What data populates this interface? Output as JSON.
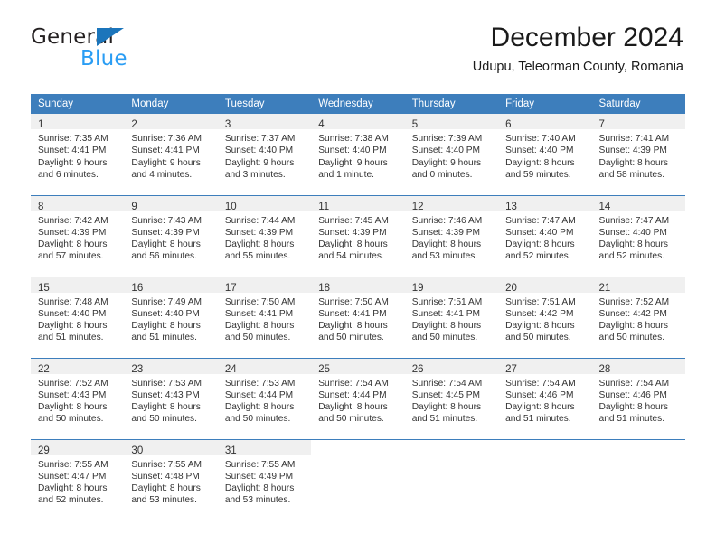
{
  "brand": {
    "name_dark": "General",
    "name_light": "Blue",
    "accent_blue": "#1b75bb",
    "light_blue": "#2a9df4"
  },
  "header": {
    "title": "December 2024",
    "subtitle": "Udupu, Teleorman County, Romania"
  },
  "theme": {
    "header_row_bg": "#3d7ebc",
    "daynum_band_bg": "#f0f0f0",
    "grid_line": "#3d7ebc",
    "text": "#333333"
  },
  "weekday_headers": [
    "Sunday",
    "Monday",
    "Tuesday",
    "Wednesday",
    "Thursday",
    "Friday",
    "Saturday"
  ],
  "weeks": [
    [
      {
        "day": "1",
        "sunrise": "Sunrise: 7:35 AM",
        "sunset": "Sunset: 4:41 PM",
        "daylight_1": "Daylight: 9 hours",
        "daylight_2": "and 6 minutes."
      },
      {
        "day": "2",
        "sunrise": "Sunrise: 7:36 AM",
        "sunset": "Sunset: 4:41 PM",
        "daylight_1": "Daylight: 9 hours",
        "daylight_2": "and 4 minutes."
      },
      {
        "day": "3",
        "sunrise": "Sunrise: 7:37 AM",
        "sunset": "Sunset: 4:40 PM",
        "daylight_1": "Daylight: 9 hours",
        "daylight_2": "and 3 minutes."
      },
      {
        "day": "4",
        "sunrise": "Sunrise: 7:38 AM",
        "sunset": "Sunset: 4:40 PM",
        "daylight_1": "Daylight: 9 hours",
        "daylight_2": "and 1 minute."
      },
      {
        "day": "5",
        "sunrise": "Sunrise: 7:39 AM",
        "sunset": "Sunset: 4:40 PM",
        "daylight_1": "Daylight: 9 hours",
        "daylight_2": "and 0 minutes."
      },
      {
        "day": "6",
        "sunrise": "Sunrise: 7:40 AM",
        "sunset": "Sunset: 4:40 PM",
        "daylight_1": "Daylight: 8 hours",
        "daylight_2": "and 59 minutes."
      },
      {
        "day": "7",
        "sunrise": "Sunrise: 7:41 AM",
        "sunset": "Sunset: 4:39 PM",
        "daylight_1": "Daylight: 8 hours",
        "daylight_2": "and 58 minutes."
      }
    ],
    [
      {
        "day": "8",
        "sunrise": "Sunrise: 7:42 AM",
        "sunset": "Sunset: 4:39 PM",
        "daylight_1": "Daylight: 8 hours",
        "daylight_2": "and 57 minutes."
      },
      {
        "day": "9",
        "sunrise": "Sunrise: 7:43 AM",
        "sunset": "Sunset: 4:39 PM",
        "daylight_1": "Daylight: 8 hours",
        "daylight_2": "and 56 minutes."
      },
      {
        "day": "10",
        "sunrise": "Sunrise: 7:44 AM",
        "sunset": "Sunset: 4:39 PM",
        "daylight_1": "Daylight: 8 hours",
        "daylight_2": "and 55 minutes."
      },
      {
        "day": "11",
        "sunrise": "Sunrise: 7:45 AM",
        "sunset": "Sunset: 4:39 PM",
        "daylight_1": "Daylight: 8 hours",
        "daylight_2": "and 54 minutes."
      },
      {
        "day": "12",
        "sunrise": "Sunrise: 7:46 AM",
        "sunset": "Sunset: 4:39 PM",
        "daylight_1": "Daylight: 8 hours",
        "daylight_2": "and 53 minutes."
      },
      {
        "day": "13",
        "sunrise": "Sunrise: 7:47 AM",
        "sunset": "Sunset: 4:40 PM",
        "daylight_1": "Daylight: 8 hours",
        "daylight_2": "and 52 minutes."
      },
      {
        "day": "14",
        "sunrise": "Sunrise: 7:47 AM",
        "sunset": "Sunset: 4:40 PM",
        "daylight_1": "Daylight: 8 hours",
        "daylight_2": "and 52 minutes."
      }
    ],
    [
      {
        "day": "15",
        "sunrise": "Sunrise: 7:48 AM",
        "sunset": "Sunset: 4:40 PM",
        "daylight_1": "Daylight: 8 hours",
        "daylight_2": "and 51 minutes."
      },
      {
        "day": "16",
        "sunrise": "Sunrise: 7:49 AM",
        "sunset": "Sunset: 4:40 PM",
        "daylight_1": "Daylight: 8 hours",
        "daylight_2": "and 51 minutes."
      },
      {
        "day": "17",
        "sunrise": "Sunrise: 7:50 AM",
        "sunset": "Sunset: 4:41 PM",
        "daylight_1": "Daylight: 8 hours",
        "daylight_2": "and 50 minutes."
      },
      {
        "day": "18",
        "sunrise": "Sunrise: 7:50 AM",
        "sunset": "Sunset: 4:41 PM",
        "daylight_1": "Daylight: 8 hours",
        "daylight_2": "and 50 minutes."
      },
      {
        "day": "19",
        "sunrise": "Sunrise: 7:51 AM",
        "sunset": "Sunset: 4:41 PM",
        "daylight_1": "Daylight: 8 hours",
        "daylight_2": "and 50 minutes."
      },
      {
        "day": "20",
        "sunrise": "Sunrise: 7:51 AM",
        "sunset": "Sunset: 4:42 PM",
        "daylight_1": "Daylight: 8 hours",
        "daylight_2": "and 50 minutes."
      },
      {
        "day": "21",
        "sunrise": "Sunrise: 7:52 AM",
        "sunset": "Sunset: 4:42 PM",
        "daylight_1": "Daylight: 8 hours",
        "daylight_2": "and 50 minutes."
      }
    ],
    [
      {
        "day": "22",
        "sunrise": "Sunrise: 7:52 AM",
        "sunset": "Sunset: 4:43 PM",
        "daylight_1": "Daylight: 8 hours",
        "daylight_2": "and 50 minutes."
      },
      {
        "day": "23",
        "sunrise": "Sunrise: 7:53 AM",
        "sunset": "Sunset: 4:43 PM",
        "daylight_1": "Daylight: 8 hours",
        "daylight_2": "and 50 minutes."
      },
      {
        "day": "24",
        "sunrise": "Sunrise: 7:53 AM",
        "sunset": "Sunset: 4:44 PM",
        "daylight_1": "Daylight: 8 hours",
        "daylight_2": "and 50 minutes."
      },
      {
        "day": "25",
        "sunrise": "Sunrise: 7:54 AM",
        "sunset": "Sunset: 4:44 PM",
        "daylight_1": "Daylight: 8 hours",
        "daylight_2": "and 50 minutes."
      },
      {
        "day": "26",
        "sunrise": "Sunrise: 7:54 AM",
        "sunset": "Sunset: 4:45 PM",
        "daylight_1": "Daylight: 8 hours",
        "daylight_2": "and 51 minutes."
      },
      {
        "day": "27",
        "sunrise": "Sunrise: 7:54 AM",
        "sunset": "Sunset: 4:46 PM",
        "daylight_1": "Daylight: 8 hours",
        "daylight_2": "and 51 minutes."
      },
      {
        "day": "28",
        "sunrise": "Sunrise: 7:54 AM",
        "sunset": "Sunset: 4:46 PM",
        "daylight_1": "Daylight: 8 hours",
        "daylight_2": "and 51 minutes."
      }
    ],
    [
      {
        "day": "29",
        "sunrise": "Sunrise: 7:55 AM",
        "sunset": "Sunset: 4:47 PM",
        "daylight_1": "Daylight: 8 hours",
        "daylight_2": "and 52 minutes."
      },
      {
        "day": "30",
        "sunrise": "Sunrise: 7:55 AM",
        "sunset": "Sunset: 4:48 PM",
        "daylight_1": "Daylight: 8 hours",
        "daylight_2": "and 53 minutes."
      },
      {
        "day": "31",
        "sunrise": "Sunrise: 7:55 AM",
        "sunset": "Sunset: 4:49 PM",
        "daylight_1": "Daylight: 8 hours",
        "daylight_2": "and 53 minutes."
      },
      {
        "day": "",
        "sunrise": "",
        "sunset": "",
        "daylight_1": "",
        "daylight_2": ""
      },
      {
        "day": "",
        "sunrise": "",
        "sunset": "",
        "daylight_1": "",
        "daylight_2": ""
      },
      {
        "day": "",
        "sunrise": "",
        "sunset": "",
        "daylight_1": "",
        "daylight_2": ""
      },
      {
        "day": "",
        "sunrise": "",
        "sunset": "",
        "daylight_1": "",
        "daylight_2": ""
      }
    ]
  ]
}
